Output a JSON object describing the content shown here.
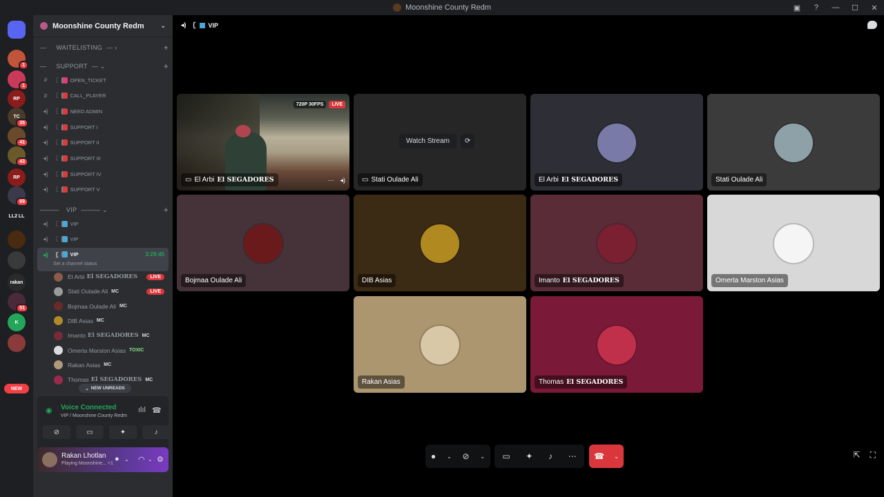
{
  "window": {
    "title": "Moonshine County Redm"
  },
  "servers": [
    {
      "label": "",
      "badge": "",
      "color": "#5865f2"
    },
    {
      "label": "",
      "badge": "1",
      "color": "#c2543a"
    },
    {
      "label": "",
      "badge": "1",
      "color": "#c93a58"
    },
    {
      "label": "RP",
      "badge": "",
      "color": "#8a1c1c"
    },
    {
      "label": "TC",
      "badge": "35",
      "color": "#4a3a2a"
    },
    {
      "label": "",
      "badge": "41",
      "color": "#6a4a2a"
    },
    {
      "label": "",
      "badge": "43",
      "color": "#6a5a2a"
    },
    {
      "label": "RP",
      "badge": "",
      "color": "#8a1c1c"
    },
    {
      "label": "",
      "badge": "69",
      "color": "#3a3a4a"
    },
    {
      "label": "LL2 LL",
      "badge": "",
      "color": "#1e1f22"
    },
    {
      "label": "",
      "badge": "",
      "color": "#4a2a10"
    },
    {
      "label": "",
      "badge": "",
      "color": "#3a3a3a"
    },
    {
      "label": "rakan",
      "badge": "",
      "color": "#2a2a2a"
    },
    {
      "label": "",
      "badge": "51",
      "color": "#4a2a3a"
    },
    {
      "label": "K",
      "badge": "",
      "color": "#23a55a"
    },
    {
      "label": "",
      "badge": "",
      "color": "#8a3a3a"
    }
  ],
  "new_label": "NEW",
  "guild": {
    "name": "Moonshine County Redm"
  },
  "categories": [
    "WAITELISTING",
    "SUPPORT",
    "VIP"
  ],
  "channels": [
    {
      "icon": "#",
      "name": "OPEN_TICKET"
    },
    {
      "icon": "#",
      "name": "CALL_PLAYER"
    },
    {
      "icon": "speaker",
      "name": "NEED ADMIN"
    },
    {
      "icon": "speaker",
      "name": "SUPPORT I"
    },
    {
      "icon": "speaker",
      "name": "SUPPORT II"
    },
    {
      "icon": "speaker",
      "name": "SUPPORT III"
    },
    {
      "icon": "speaker",
      "name": "SUPPORT IV"
    },
    {
      "icon": "speaker",
      "name": "SUPPORT V"
    }
  ],
  "vip_channels": [
    {
      "name": "VIP"
    },
    {
      "name": "VIP"
    },
    {
      "name": "VIP",
      "timer": "3:29:45",
      "status": "Set a channel status"
    }
  ],
  "voice_users": [
    {
      "name": "El Arbi",
      "surname": "El SEGADORES",
      "tag": "",
      "live": "LIVE",
      "color": "#8a5a4a"
    },
    {
      "name": "Stati Oulade Ali",
      "surname": "",
      "tag": "MC",
      "live": "LIVE",
      "color": "#9a9a9a"
    },
    {
      "name": "Bojmaa Oulade Ali",
      "surname": "",
      "tag": "MC",
      "live": "",
      "color": "#6a2a2a"
    },
    {
      "name": "DIB Asias",
      "surname": "",
      "tag": "MC",
      "live": "",
      "color": "#b08a2a"
    },
    {
      "name": "Imanto",
      "surname": "El SEGADORES",
      "tag": "MC",
      "live": "",
      "color": "#7a2a3a"
    },
    {
      "name": "Omerta Marston Asias",
      "surname": "",
      "tag": "TOXIC",
      "live": "",
      "color": "#dbdbdb"
    },
    {
      "name": "Rakan Asias",
      "surname": "",
      "tag": "MC",
      "live": "",
      "color": "#b09a7a"
    },
    {
      "name": "Thomas",
      "surname": "El SEGADORES",
      "tag": "MC",
      "live": "",
      "color": "#9a2a4a"
    }
  ],
  "new_unreads": "NEW UNREADS",
  "voice": {
    "title": "Voice Connected",
    "subtitle": "VIP / Moonshine County Redm"
  },
  "user": {
    "name": "Rakan Lhotlan",
    "status": "Playing Moonshine... +1"
  },
  "stage": {
    "channel": "VIP"
  },
  "tiles": [
    {
      "name": "El Arbi",
      "surname": "El SEGADORES",
      "bg": "#3a3a3a",
      "type": "stream",
      "resolution": "720P 30FPS",
      "live": "LIVE"
    },
    {
      "name": "Stati Oulade Ali",
      "surname": "",
      "bg": "#262626",
      "type": "preview",
      "watch": "Watch Stream"
    },
    {
      "name": "El Arbi",
      "surname": "El SEGADORES",
      "bg": "#2e2f36",
      "type": "avatar",
      "avatar": "#7a7aa8"
    },
    {
      "name": "Stati Oulade Ali",
      "surname": "",
      "bg": "#3a3b3a",
      "type": "avatar",
      "avatar": "#8ea0a8"
    },
    {
      "name": "Bojmaa Oulade Ali",
      "surname": "",
      "bg": "#463339",
      "type": "avatar",
      "avatar": "#6a1a1a"
    },
    {
      "name": "DIB Asias",
      "surname": "",
      "bg": "#3c2b14",
      "type": "avatar",
      "avatar": "#b08a20"
    },
    {
      "name": "Imanto",
      "surname": "El SEGADORES",
      "bg": "#5a2c38",
      "type": "avatar",
      "avatar": "#7a2030"
    },
    {
      "name": "Omerta Marston Asias",
      "surname": "",
      "bg": "#d8d8d8",
      "type": "avatar",
      "avatar": "#f5f5f5"
    },
    {
      "name": "Rakan Asias",
      "surname": "",
      "bg": "#ab9670",
      "type": "avatar",
      "avatar": "#d8c8a8"
    },
    {
      "name": "Thomas",
      "surname": "El SEGADORES",
      "bg": "#7a1a38",
      "type": "avatar",
      "avatar": "#c0304a"
    }
  ]
}
